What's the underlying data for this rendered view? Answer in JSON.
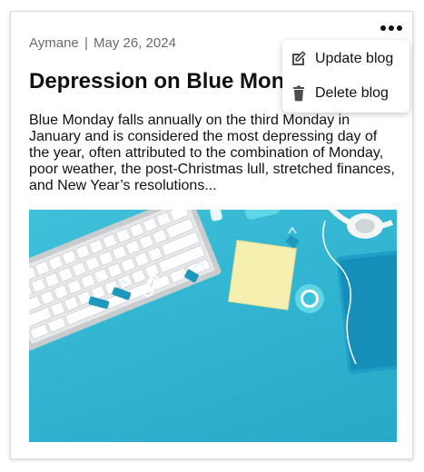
{
  "post": {
    "author": "Aymane",
    "separator": "|",
    "date": "May 26, 2024",
    "title": "Depression on Blue Monday",
    "excerpt": "Blue Monday falls annually on the third Monday in January and is considered the most depressing day of the year, often attributed to the combination of Monday, poor weather, the post-Christmas lull, stretched finances, and New Year’s resolutions..."
  },
  "menu": {
    "update_label": "Update blog",
    "delete_label": "Delete blog"
  },
  "icons": {
    "more": "more-horizontal-icon",
    "update": "edit-icon",
    "delete": "trash-icon"
  },
  "colors": {
    "image_background": "#2fb3d0",
    "meta_text": "#6b6b6b"
  }
}
